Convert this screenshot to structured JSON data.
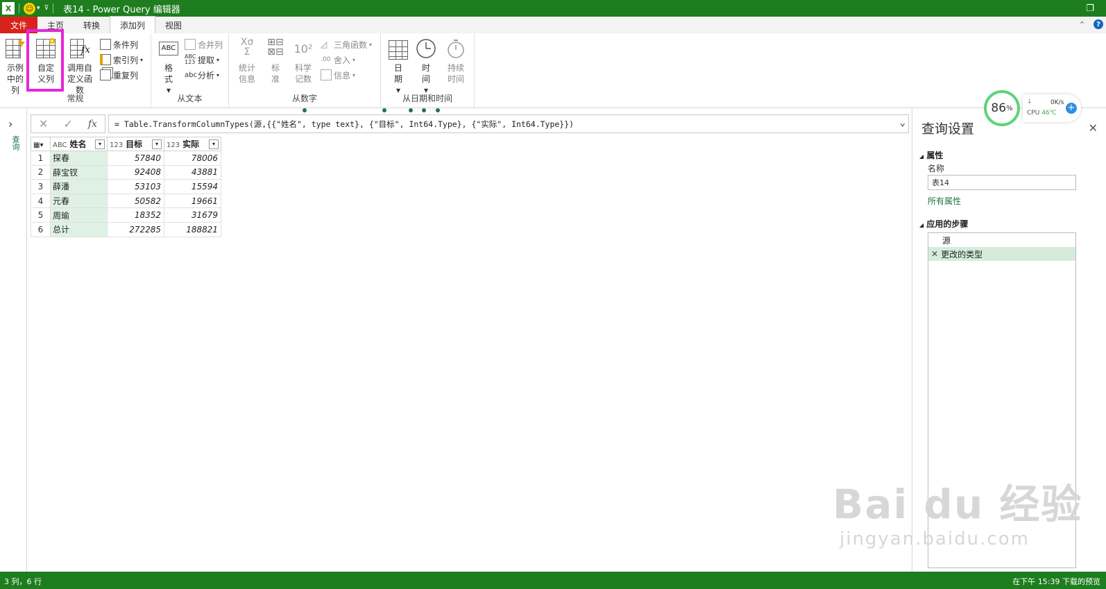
{
  "titlebar": {
    "logo": "X",
    "title": "表14 - Power Query 编辑器"
  },
  "tabs": {
    "file": "文件",
    "home": "主页",
    "transform": "转换",
    "add_column": "添加列",
    "view": "视图"
  },
  "ribbon": {
    "general": {
      "label": "常规",
      "example_column": "示例中的列",
      "custom_column": "自定义列",
      "invoke_function": "调用自定义函数",
      "conditional_column": "条件列",
      "index_column": "索引列",
      "duplicate_column": "重复列"
    },
    "from_text": {
      "label": "从文本",
      "format": "格式",
      "merge_columns": "合并列",
      "extract": "提取",
      "parse": "分析"
    },
    "from_number": {
      "label": "从数字",
      "statistics": "统计信息",
      "standard": "标准",
      "scientific": "科学记数",
      "trigonometry": "三角函数",
      "rounding": "舍入",
      "information": "信息"
    },
    "from_datetime": {
      "label": "从日期和时间",
      "date": "日期",
      "time": "时间",
      "duration": "持续时间"
    }
  },
  "left_strip": {
    "label": "查询"
  },
  "formula": {
    "text": "= Table.TransformColumnTypes(源,{{\"姓名\", type text}, {\"目标\", Int64.Type}, {\"实际\", Int64.Type}})"
  },
  "table": {
    "columns": [
      {
        "type": "ABC",
        "name": "姓名"
      },
      {
        "type": "123",
        "name": "目标"
      },
      {
        "type": "123",
        "name": "实际"
      }
    ],
    "rows": [
      {
        "idx": "1",
        "name": "探春",
        "target": "57840",
        "actual": "78006"
      },
      {
        "idx": "2",
        "name": "薛宝钗",
        "target": "92408",
        "actual": "43881"
      },
      {
        "idx": "3",
        "name": "薛潘",
        "target": "53103",
        "actual": "15594"
      },
      {
        "idx": "4",
        "name": "元春",
        "target": "50582",
        "actual": "19661"
      },
      {
        "idx": "5",
        "name": "周瑜",
        "target": "18352",
        "actual": "31679"
      },
      {
        "idx": "6",
        "name": "总计",
        "target": "272285",
        "actual": "188821"
      }
    ]
  },
  "query_settings": {
    "title": "查询设置",
    "properties_section": "属性",
    "name_label": "名称",
    "name_value": "表14",
    "all_properties": "所有属性",
    "applied_steps_section": "应用的步骤",
    "steps": [
      "源",
      "更改的类型"
    ]
  },
  "cpu_widget": {
    "percent": "86",
    "percent_sign": "%",
    "speed": "0K/s",
    "cpu_label": "CPU",
    "temp": "46℃"
  },
  "watermark": {
    "main": "Bai du 经验",
    "sub": "jingyan.baidu.com"
  },
  "status": {
    "left": "3 列，6 行",
    "right": "在下午 15:39 下载的预览"
  },
  "colors": {
    "accent": "#1e7d1f",
    "file_tab": "#d8231b",
    "highlight": "#e327d8",
    "selected_cell": "#dff1e4"
  }
}
